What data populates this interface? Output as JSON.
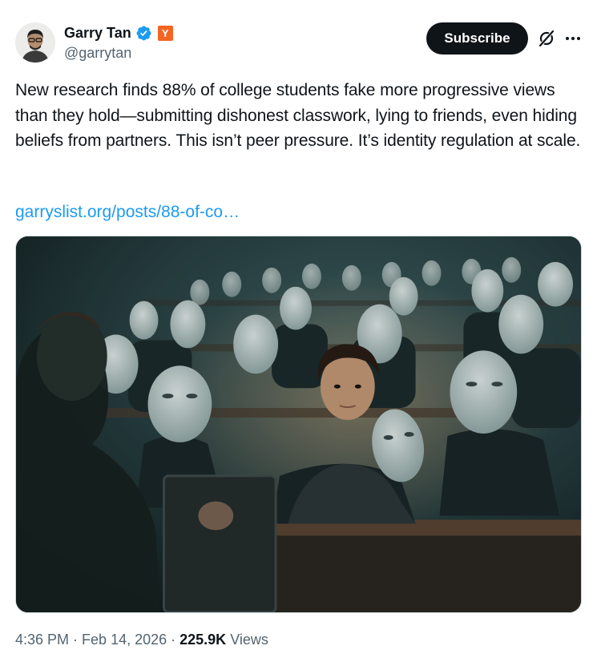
{
  "author": {
    "name": "Garry Tan",
    "handle": "@garrytan",
    "badge_letter": "Y",
    "verified_color": "#1d9bf0",
    "badge_color": "#f26522"
  },
  "actions": {
    "subscribe_label": "Subscribe",
    "grok_icon": "grok-icon",
    "more_icon": "more-icon"
  },
  "tweet": {
    "text": "New research finds 88% of college students fake more progressive views than they hold—submitting dishonest classwork, lying to friends, even hiding beliefs from partners. This isn’t peer pressure. It’s identity regulation at scale.",
    "link_text": "garryslist.org/posts/88-of-co…"
  },
  "meta": {
    "time": "4:36 PM",
    "separator": "·",
    "date": "Feb 14, 2026",
    "views_count": "225.9K",
    "views_label": "Views"
  }
}
